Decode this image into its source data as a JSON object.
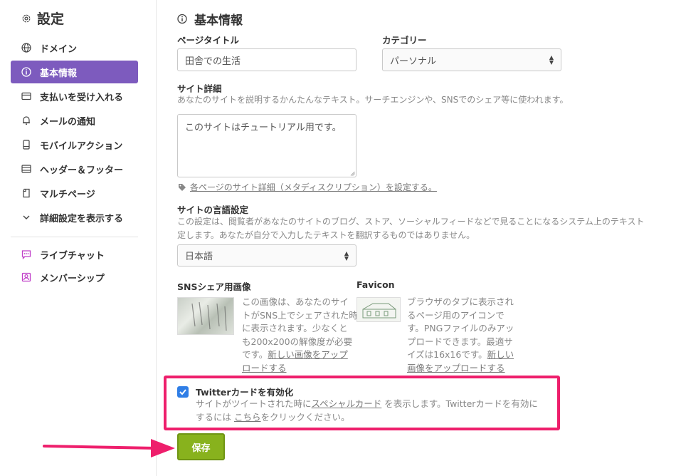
{
  "sidebar": {
    "title": "設定",
    "items": [
      {
        "label": "ドメイン",
        "icon": "globe-icon"
      },
      {
        "label": "基本情報",
        "icon": "info-icon"
      },
      {
        "label": "支払いを受け入れる",
        "icon": "card-icon"
      },
      {
        "label": "メールの通知",
        "icon": "bell-icon"
      },
      {
        "label": "モバイルアクション",
        "icon": "mobile-icon"
      },
      {
        "label": "ヘッダー＆フッター",
        "icon": "header-footer-icon"
      },
      {
        "label": "マルチページ",
        "icon": "pages-icon"
      },
      {
        "label": "詳細設定を表示する",
        "icon": "chevron-down-icon"
      }
    ],
    "apps": [
      {
        "label": "ライブチャット",
        "icon": "chat-icon"
      },
      {
        "label": "メンバーシップ",
        "icon": "member-icon"
      }
    ],
    "active_color": "#7d5bbe"
  },
  "main": {
    "section_title": "基本情報",
    "page_title": {
      "label": "ページタイトル",
      "value": "田舎での生活"
    },
    "category": {
      "label": "カテゴリー",
      "value": "パーソナル"
    },
    "site_detail": {
      "label": "サイト詳細",
      "description": "あなたのサイトを説明するかんたんなテキスト。サーチエンジンや、SNSでのシェア等に使われます。",
      "value": "このサイトはチュートリアル用です。",
      "meta_link": "各ページのサイト詳細（メタディスクリプション）を設定する。"
    },
    "language": {
      "label": "サイトの言語設定",
      "description_line1": "この設定は、閲覧者があなたのサイトのブログ、ストア、ソーシャルフィードなどで見ることになるシステム上のテキスト",
      "description_line2": "定します。あなたが自分で入力したテキストを翻訳するものではありません。",
      "value": "日本語"
    },
    "sns_image": {
      "label": "SNSシェア用画像",
      "line1": "この画像は、あなたのサイ",
      "line2": "トがSNS上でシェアされた時",
      "line3": "に表示されます。少なくと",
      "line4": "も200x200の解像度が必要",
      "line5_prefix": "です。",
      "line5_link": "新しい画像をアップ",
      "line6_link": "ロードする"
    },
    "favicon": {
      "label": "Favicon",
      "line1": "ブラウザのタブに表示され",
      "line2": "るページ用のアイコンで",
      "line3": "す。PNGファイルのみアッ",
      "line4": "プロードできます。最適サ",
      "line5_prefix": "イズは16x16です。",
      "line5_link": "新しい",
      "line6_link": "画像をアップロードする"
    },
    "twitter": {
      "label": "Twitterカードを有効化",
      "checked": true,
      "line1_prefix": "サイトがツイートされた時に",
      "line1_link": "スペシャルカード",
      "line1_suffix": "を表示します。Twitterカードを有効に",
      "line2_prefix": "するには",
      "line2_link": "こちら",
      "line2_suffix": "をクリックください。"
    },
    "save_label": "保存",
    "save_color": "#88b21d",
    "highlight_color": "#ee1f6c"
  }
}
